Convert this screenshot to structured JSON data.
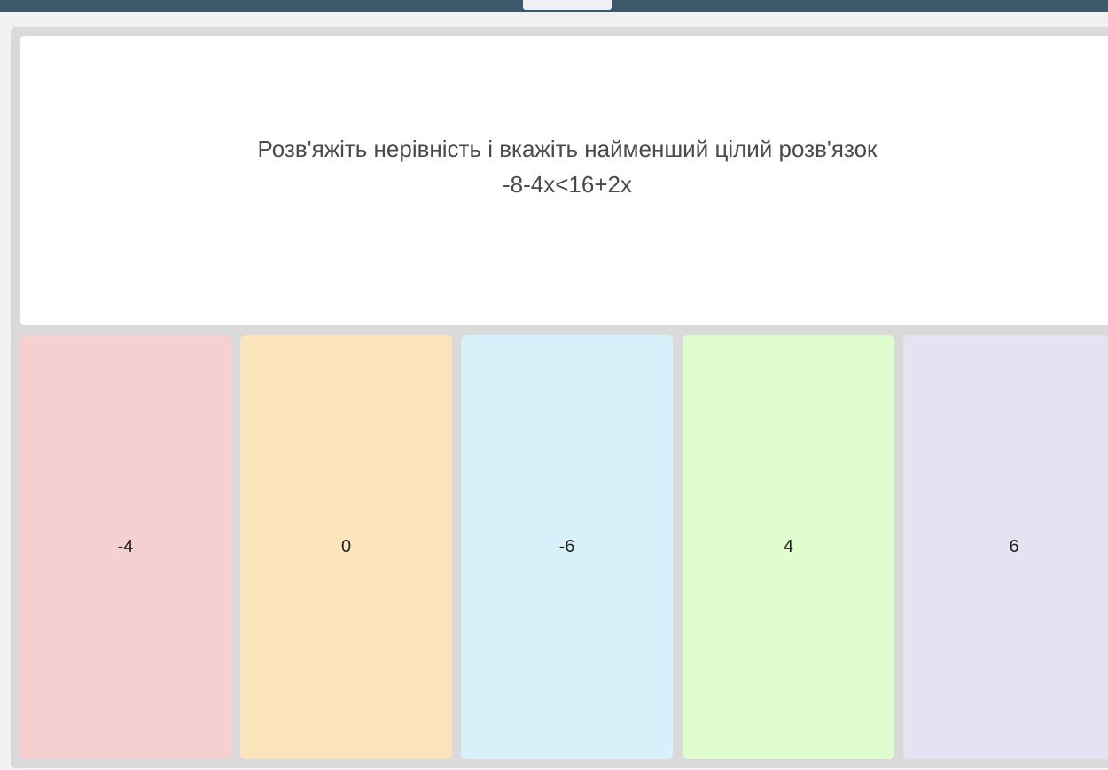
{
  "question": {
    "line1": "Розв'яжіть нерівність і вкажіть найменший цілий розв'язок",
    "line2": "-8-4x<16+2x"
  },
  "answers": [
    {
      "label": "-4",
      "color": "#f6d0d1"
    },
    {
      "label": "0",
      "color": "#fbe3bb"
    },
    {
      "label": "-6",
      "color": "#d8f0fa"
    },
    {
      "label": "4",
      "color": "#e0fdd0"
    },
    {
      "label": "6",
      "color": "#e4e3f1"
    }
  ]
}
